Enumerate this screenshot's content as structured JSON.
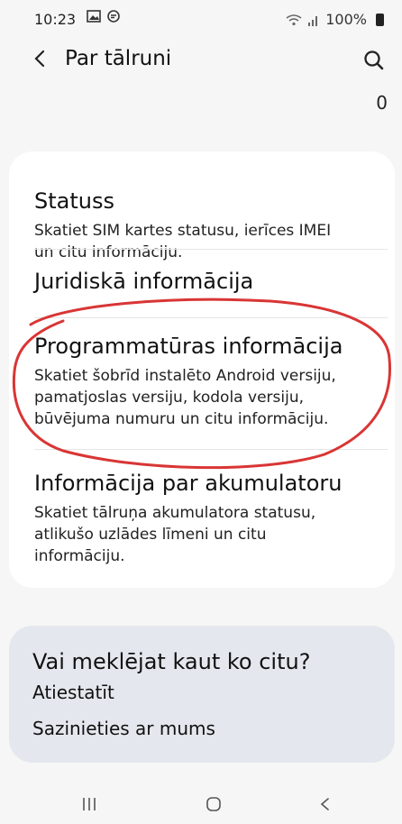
{
  "status_bar": {
    "time": "10:23",
    "icons_left": [
      "gallery-icon",
      "message-icon"
    ],
    "icons_right": [
      "wifi-icon",
      "signal-icon"
    ],
    "battery": "100%"
  },
  "header": {
    "title": "Par tālruni",
    "counter": "0"
  },
  "items": [
    {
      "title": "Statuss",
      "desc_lines": [
        "Skatiet SIM kartes statusu, ierīces IMEI",
        "un citu informāciju."
      ]
    },
    {
      "title": "Juridiskā informācija",
      "desc_lines": []
    },
    {
      "title": "Programmatūras informācija",
      "desc_lines": [
        "Skatiet šobrīd instalēto Android versiju,",
        "pamatjoslas versiju, kodola versiju,",
        "būvējuma numuru un citu informāciju."
      ]
    },
    {
      "title": "Informācija par akumulatoru",
      "desc_lines": [
        "Skatiet tālruņa akumulatora statusu,",
        "atlikušo uzlādes līmeni un citu",
        "informāciju."
      ]
    }
  ],
  "suggestions": {
    "title": "Vai meklējat kaut ko citu?",
    "links": [
      "Atiestatīt",
      "Sazinieties ar mums"
    ]
  },
  "colors": {
    "annotation": "#d93535",
    "suggestion_bg": "#e4e8ee"
  }
}
